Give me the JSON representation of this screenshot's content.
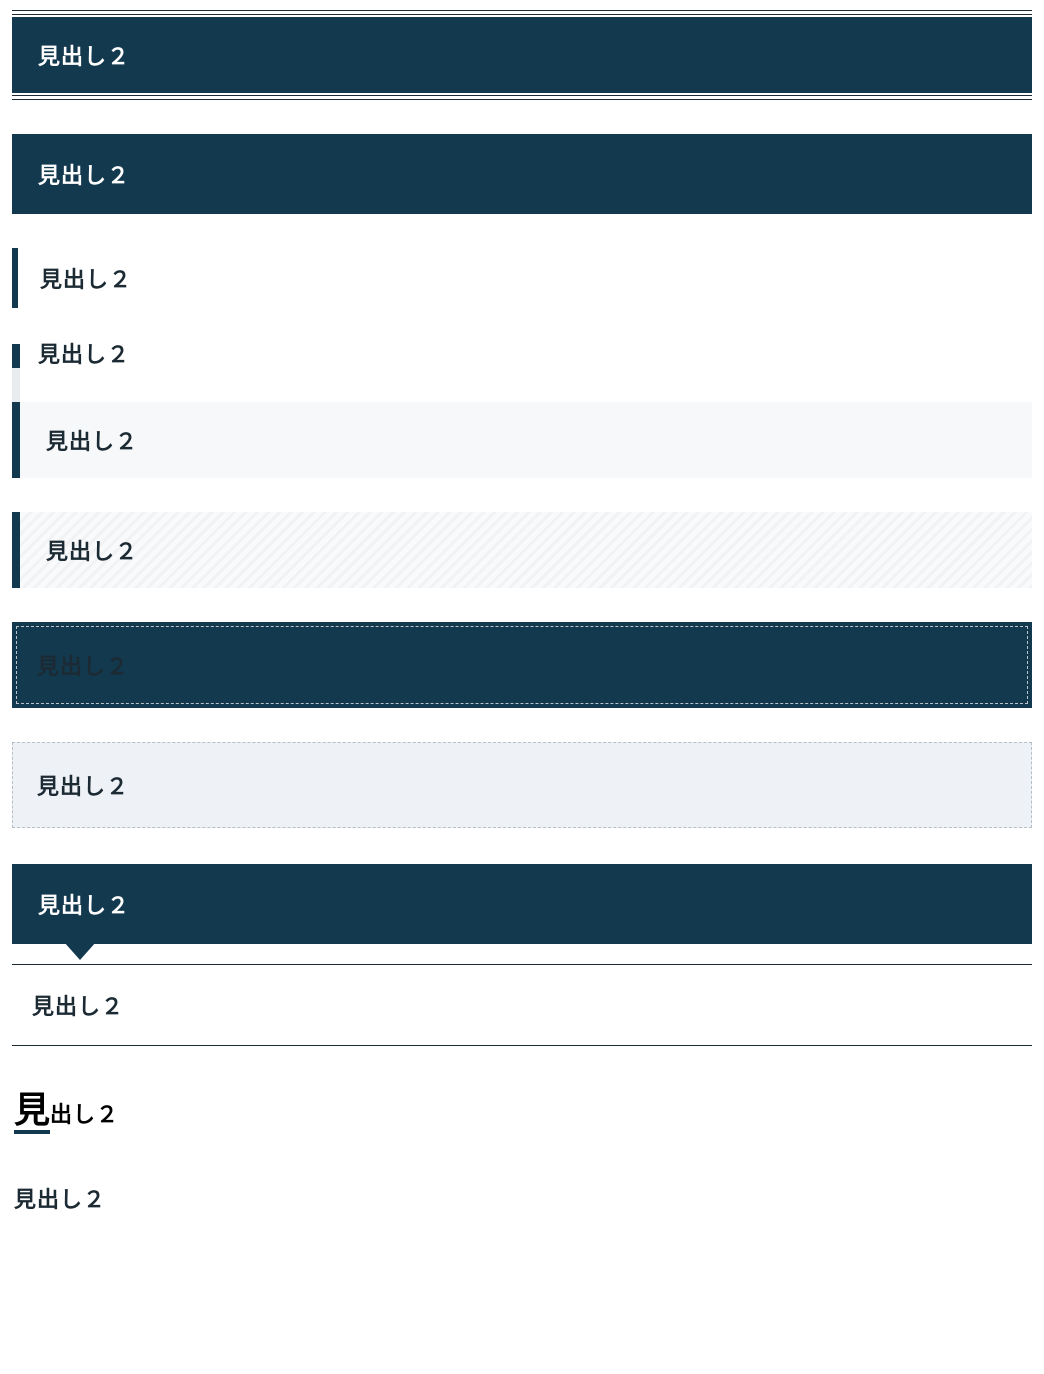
{
  "headings": {
    "style1": "見出し２",
    "style2": "見出し２",
    "style3": "見出し２",
    "style4": "見出し２",
    "style5": "見出し２",
    "style6": "見出し２",
    "style7": "見出し２",
    "style8": "見出し２",
    "style9": "見出し２",
    "style10": "見出し２",
    "style11_first": "見",
    "style11_rest": "出し２",
    "style12": "見出し２"
  }
}
